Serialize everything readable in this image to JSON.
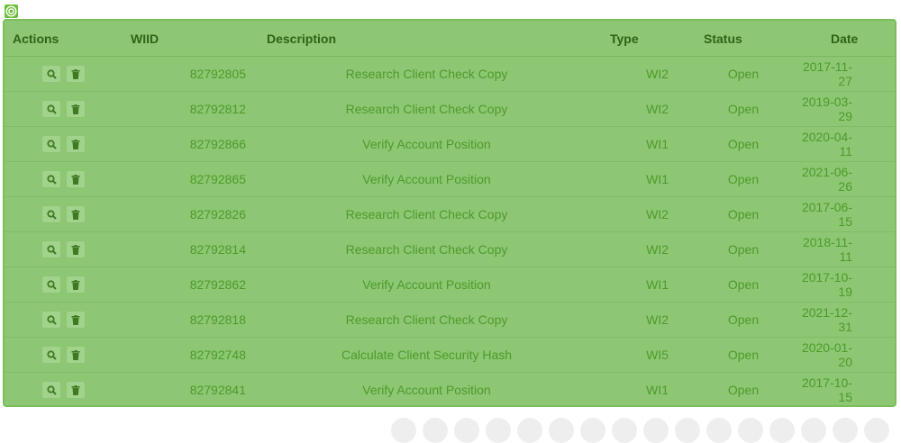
{
  "table": {
    "headers": {
      "actions": "Actions",
      "wiid": "WIID",
      "description": "Description",
      "type": "Type",
      "status": "Status",
      "date": "Date"
    },
    "rows": [
      {
        "wiid": "82792805",
        "description": "Research Client Check Copy",
        "type": "WI2",
        "status": "Open",
        "date": "2017-11-27"
      },
      {
        "wiid": "82792812",
        "description": "Research Client Check Copy",
        "type": "WI2",
        "status": "Open",
        "date": "2019-03-29"
      },
      {
        "wiid": "82792866",
        "description": "Verify Account Position",
        "type": "WI1",
        "status": "Open",
        "date": "2020-04-11"
      },
      {
        "wiid": "82792865",
        "description": "Verify Account Position",
        "type": "WI1",
        "status": "Open",
        "date": "2021-06-26"
      },
      {
        "wiid": "82792826",
        "description": "Research Client Check Copy",
        "type": "WI2",
        "status": "Open",
        "date": "2017-06-15"
      },
      {
        "wiid": "82792814",
        "description": "Research Client Check Copy",
        "type": "WI2",
        "status": "Open",
        "date": "2018-11-11"
      },
      {
        "wiid": "82792862",
        "description": "Verify Account Position",
        "type": "WI1",
        "status": "Open",
        "date": "2017-10-19"
      },
      {
        "wiid": "82792818",
        "description": "Research Client Check Copy",
        "type": "WI2",
        "status": "Open",
        "date": "2021-12-31"
      },
      {
        "wiid": "82792748",
        "description": "Calculate Client Security Hash",
        "type": "WI5",
        "status": "Open",
        "date": "2020-01-20"
      },
      {
        "wiid": "82792841",
        "description": "Verify Account Position",
        "type": "WI1",
        "status": "Open",
        "date": "2017-10-15"
      }
    ],
    "row_actions": [
      "search-icon",
      "trash-icon"
    ]
  },
  "pagination": {
    "page_count": 16
  },
  "colors": {
    "panel": "#8dc773",
    "panel_border": "#7ac05a",
    "header_text": "#2f6318",
    "cell_text": "#4e9a2c",
    "icon": "#3f7a23",
    "badge": "#6cbf3a"
  }
}
